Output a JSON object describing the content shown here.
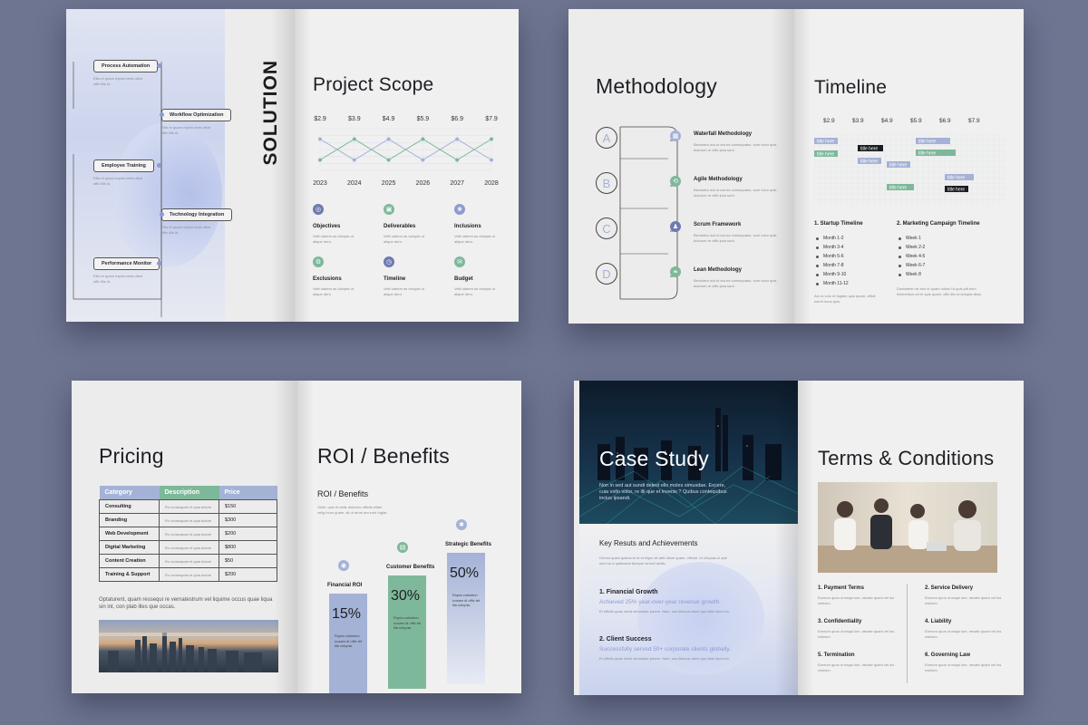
{
  "solution": {
    "heading": "SOLUTION",
    "steps": [
      {
        "label": "Process Automation"
      },
      {
        "label": "Workflow Optimization"
      },
      {
        "label": "Employee Training"
      },
      {
        "label": "Technology Integration"
      },
      {
        "label": "Performance Monitor"
      }
    ]
  },
  "project_scope": {
    "title": "Project Scope",
    "items": [
      {
        "label": "Objectives",
        "icon": "target-icon"
      },
      {
        "label": "Deliverables",
        "icon": "box-icon"
      },
      {
        "label": "Inclusions",
        "icon": "plant-icon"
      },
      {
        "label": "Exclusions",
        "icon": "gear-icon"
      },
      {
        "label": "Timeline",
        "icon": "clock-icon"
      },
      {
        "label": "Budget",
        "icon": "chat-icon"
      }
    ]
  },
  "chart_data": {
    "type": "line",
    "x": [
      "2023",
      "2024",
      "2025",
      "2026",
      "2027",
      "2028"
    ],
    "top_labels": [
      "$2.9",
      "$3.9",
      "$4.9",
      "$5.9",
      "$6.9",
      "$7.9"
    ],
    "series": [
      {
        "color": "#a4b2d6",
        "values": [
          3,
          1,
          3,
          1,
          3,
          1
        ]
      },
      {
        "color": "#7eb89a",
        "values": [
          1,
          3,
          1,
          3,
          1,
          3
        ]
      }
    ],
    "ylim": [
      0,
      4
    ],
    "grid": true
  },
  "methodology": {
    "title": "Methodology",
    "letters": [
      "A",
      "B",
      "C",
      "D"
    ],
    "items": [
      {
        "label": "Waterfall Methodology",
        "icon": "waterfall-icon",
        "color": "#a4b2d6"
      },
      {
        "label": "Agile Methodology",
        "icon": "agile-icon",
        "color": "#7eb89a"
      },
      {
        "label": "Scrum Framework",
        "icon": "scrum-icon",
        "color": "#6e7ab0"
      },
      {
        "label": "Lean Methodology",
        "icon": "lean-icon",
        "color": "#7eb89a"
      }
    ]
  },
  "timeline": {
    "title": "Timeline",
    "top_labels": [
      "$2.9",
      "$3.9",
      "$4.9",
      "$5.9",
      "$6.9",
      "$7.9"
    ],
    "gantt_label": "title here",
    "startup_title": "1. Startup Timeline",
    "startup_items": [
      "Month 1-2",
      "Month 3-4",
      "Month 5-6",
      "Month 7-8",
      "Month 9-10",
      "Month 11-12"
    ],
    "marketing_title": "2. Marketing Campaign Timeline",
    "marketing_items": [
      "Week 1",
      "Week 2-2",
      "Week 4-5",
      "Week 6-7",
      "Week 8"
    ]
  },
  "pricing": {
    "title": "Pricing",
    "headers": [
      "Category",
      "Description",
      "Price"
    ],
    "rows": [
      [
        "Consulting",
        "$150"
      ],
      [
        "Branding",
        "$300"
      ],
      [
        "Web Development",
        "$200"
      ],
      [
        "Digital Marketing",
        "$800"
      ],
      [
        "Content Creation",
        "$50"
      ],
      [
        "Training & Support",
        "$200"
      ]
    ],
    "quote": "Optaturent, quam ressequi re vernatestrum vel liquime occus quae liqua sin int, con plab illes que occas."
  },
  "roi": {
    "title": "ROI / Benefits",
    "subtitle": "ROI / Benefits",
    "bars": [
      {
        "label": "Financial ROI",
        "value": "15%",
        "color": "#a4b2d6"
      },
      {
        "label": "Customer Benefits",
        "value": "30%",
        "color": "#7eb89a"
      },
      {
        "label": "Strategic Benefits",
        "value": "50%",
        "color": "#a4b2d6"
      }
    ]
  },
  "case_study": {
    "title": "Case Study",
    "intro": "Non in sed aut sundi delest elis moles simusdae. Excere, cuia vollo volor, re illi que et invenis ? Quibus contequibus incius ipsandi.",
    "section_title": "Key Resuts and Achievements",
    "items": [
      {
        "title": "1. Financial Growth",
        "highlight": "Achieved 25% year-over-year revenue growth."
      },
      {
        "title": "2. Client Success",
        "highlight": "Successfully served 50+ corporate clients globally."
      }
    ]
  },
  "terms": {
    "title": "Terms & Conditions",
    "items": [
      "1. Payment Terms",
      "2. Service Delivery",
      "3. Confidentiality",
      "4. Liability",
      "5. Termination",
      "6. Governing Law"
    ]
  }
}
